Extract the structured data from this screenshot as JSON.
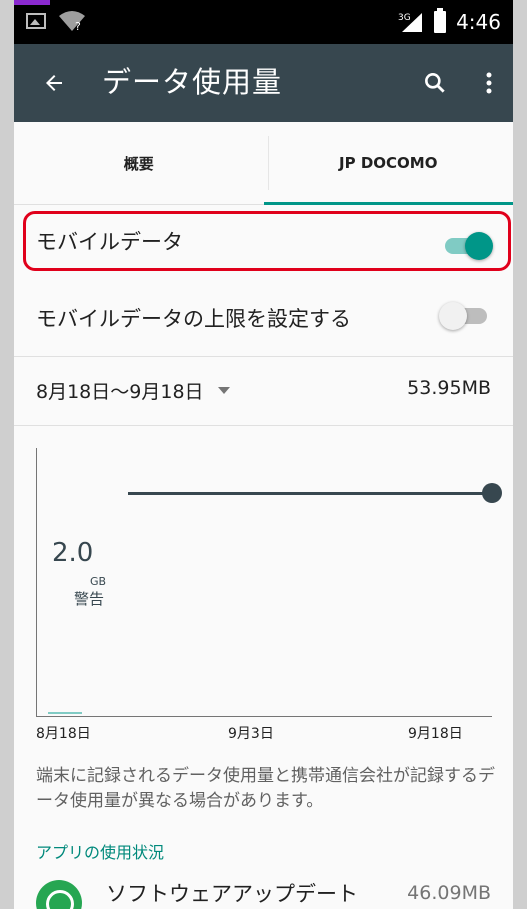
{
  "status_bar": {
    "network_type": "3G",
    "time": "4:46",
    "wifi_badge": "?"
  },
  "toolbar": {
    "title": "データ使用量",
    "back_icon": "arrow-back-icon",
    "search_icon": "search-icon",
    "more_icon": "more-vert-icon"
  },
  "tabs": [
    {
      "label": "概要",
      "selected": false
    },
    {
      "label": "JP DOCOMO",
      "selected": true
    }
  ],
  "settings": {
    "mobile_data": {
      "label": "モバイルデータ",
      "enabled": true
    },
    "mobile_data_limit": {
      "label": "モバイルデータの上限を設定する",
      "enabled": false
    }
  },
  "cycle": {
    "range": "8月18日〜9月18日",
    "total": "53.95MB"
  },
  "chart": {
    "warning_value": "2.0",
    "warning_unit": "GB",
    "warning_label": "警告",
    "x_ticks": [
      "8月18日",
      "9月3日",
      "9月18日"
    ]
  },
  "note": "端末に記録されるデータ使用量と携帯通信会社が記録するデータ使用量が異なる場合があります。",
  "app_usage": {
    "header": "アプリの使用状況",
    "items": [
      {
        "name": "ソフトウェアアップデート",
        "size": "46.09MB"
      }
    ]
  },
  "colors": {
    "toolbar": "#37474f",
    "accent": "#009688",
    "highlight": "#e0001b"
  }
}
